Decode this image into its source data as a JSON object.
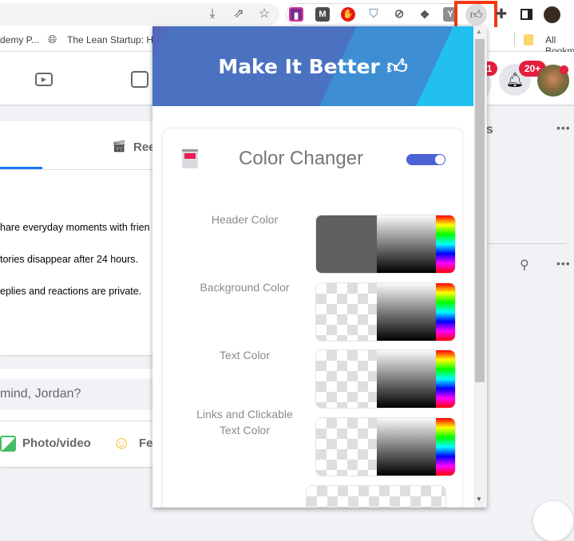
{
  "browser": {
    "toolbar_icons": [
      "download-icon",
      "share-icon",
      "star-icon"
    ],
    "extensions": [
      "analytics-extension",
      "m-extension",
      "adblock-extension",
      "shield-extension",
      "speed-extension",
      "handshake-extension",
      "y-extension",
      "thumbs-up-extension",
      "puzzle-icon",
      "sidebar-icon",
      "profile-avatar"
    ],
    "ext_labels": {
      "m": "M",
      "y": "Y"
    },
    "bookmarks": {
      "left_partial": "demy P...",
      "lean": "The Lean Startup: H...",
      "all": "All Bookmar"
    }
  },
  "facebook": {
    "badges": {
      "messages": "1",
      "notifications": "20+"
    },
    "stories_tab_reels": "Ree",
    "stories_lines": [
      "hare everyday moments with frien",
      "tories disappear after 24 hours.",
      "eplies and reactions are private."
    ],
    "composer_placeholder": "mind, Jordan?",
    "photo_video": "Photo/video",
    "feeling_partial": "Fe",
    "right_heading_partial": "es"
  },
  "popup": {
    "title": "Make It Better",
    "section_title": "Color Changer",
    "toggle_on": true,
    "accent": "#4b63d4",
    "rows": [
      {
        "label": "Header Color",
        "color": "#5f5f5f"
      },
      {
        "label": "Background Color",
        "color": null
      },
      {
        "label": "Text Color",
        "color": null
      },
      {
        "label": "Links and Clickable Text Color",
        "color": null
      }
    ]
  }
}
